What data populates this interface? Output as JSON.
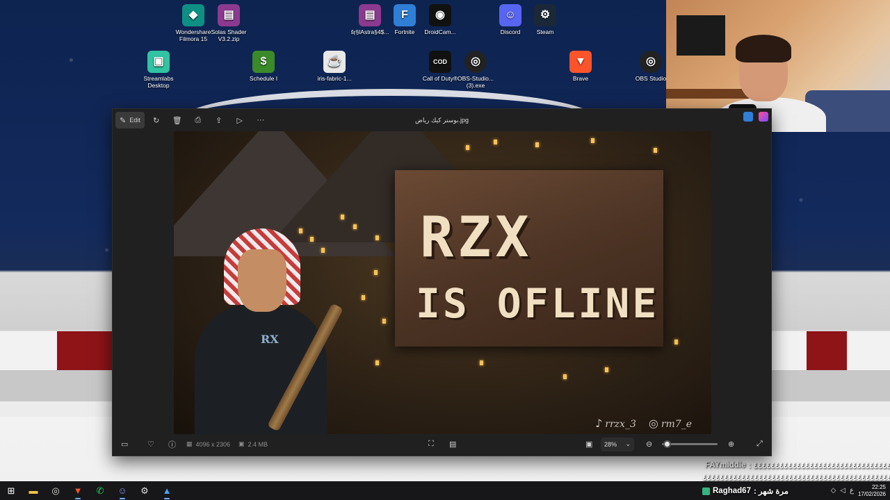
{
  "desktop_icons": [
    {
      "label": "Wondershare Filmora 15",
      "icon": "filmora-icon",
      "color": "#0e8f84",
      "glyph": "◆"
    },
    {
      "label": "Solas Shader V3.2.zip",
      "icon": "winrar-archive-icon",
      "color": "#8b3a8f",
      "glyph": "▤"
    },
    {
      "label": "ŝŗ§lAstra§4$...",
      "icon": "winrar-archive-icon",
      "color": "#8b3a8f",
      "glyph": "▤"
    },
    {
      "label": "Fortnite",
      "icon": "fortnite-icon",
      "color": "#2f7fd6",
      "glyph": "F"
    },
    {
      "label": "DroidCam...",
      "icon": "droidcam-icon",
      "color": "#111111",
      "glyph": "◉"
    },
    {
      "label": "Discord",
      "icon": "discord-icon",
      "color": "#5865f2",
      "glyph": "☺"
    },
    {
      "label": "Steam",
      "icon": "steam-icon",
      "color": "#1b2838",
      "glyph": "⚙"
    },
    {
      "label": "Streamlabs Desktop",
      "icon": "streamlabs-icon",
      "color": "#31c3a2",
      "glyph": "▣"
    },
    {
      "label": "Schedule I",
      "icon": "schedule-i-icon",
      "color": "#3a8a2a",
      "glyph": "$"
    },
    {
      "label": "iris-fabric-1...",
      "icon": "java-icon",
      "color": "#e8e8e8",
      "glyph": "☕"
    },
    {
      "label": "Call of Duty®",
      "icon": "call-of-duty-icon",
      "color": "#111111",
      "glyph": "C"
    },
    {
      "label": "OBS-Studio... (3).exe",
      "icon": "obs-studio-icon",
      "color": "#222222",
      "glyph": "◎"
    },
    {
      "label": "Brave",
      "icon": "brave-icon",
      "color": "#fb542b",
      "glyph": "▼"
    },
    {
      "label": "OBS Studio",
      "icon": "obs-studio-icon",
      "color": "#222222",
      "glyph": "◎"
    }
  ],
  "photos_window": {
    "title": "بوستر كيك رياض.jpg",
    "toolbar": {
      "edit_label": "Edit"
    },
    "image": {
      "line1": "RZX",
      "line2": "IS OFLINE",
      "chest_logo": "RX",
      "tiktok_handle": "rrzx_3",
      "instagram_handle": "rm7_e"
    },
    "status": {
      "dimensions": "4096 x 2306",
      "file_size": "2.4 MB",
      "zoom": "28%",
      "zoom_fraction": 0.05
    }
  },
  "chat": [
    {
      "user": "FAYmiddle",
      "text": ": ٤٤٤٤٤٤٤٤٤٤٤٤٤٤٤٤٤٤٤٤٤٤٤٤٤٤٤٤٤٤٤٤٤٤٤٤٤"
    },
    {
      "user": "",
      "text": "٤٤٤٤٤٤٤٤٤٤٤٤٤٤٤٤٤٤٤٤٤٤٤٤٤٤٤٤٤٤٤٤٤٤٤٤٤٤٤٤٤٤٤٤٤٤٤٤٤"
    },
    {
      "user": "Raghad67",
      "text": ": مرة شهر"
    }
  ],
  "taskbar": {
    "apps": [
      "start-icon",
      "file-explorer-icon",
      "obs-studio-icon",
      "brave-icon",
      "whatsapp-icon",
      "discord-icon",
      "steam-icon",
      "photos-icon"
    ],
    "time": "22:25",
    "date": "17/02/2026",
    "lang": "ع"
  }
}
